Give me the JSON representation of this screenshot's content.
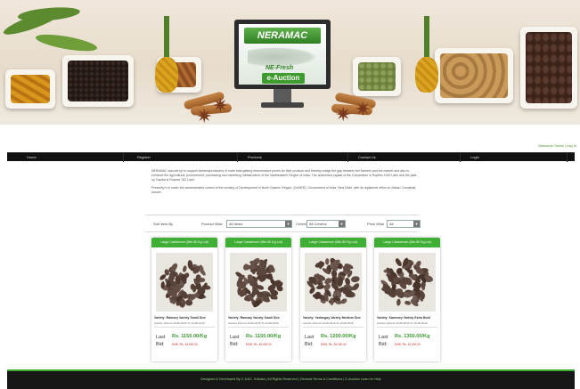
{
  "brand": {
    "logo_text": "NERAMAC",
    "subtitle": "NE-Fresh",
    "tagline": "e-Auction"
  },
  "header": {
    "welcome": "Welcome Guest | Log In"
  },
  "nav": {
    "items": [
      {
        "label": "Home"
      },
      {
        "label": "Register"
      },
      {
        "label": "Products"
      },
      {
        "label": "Contact Us"
      },
      {
        "label": "Login"
      }
    ]
  },
  "intro": {
    "paragraph1": "NERAMAC was set up to support farmers/producers of north east getting remunerative prices for their produce and thereby bridge the gap between the farmers and the market and also to enhance the agricultural, procurement, processing and marketing infrastructure of the Northeastern Region of India. The authorised capital of the Corporation is Rupees 1000 Lakh and the paid-up Capital is Rupees 762 Lakh.",
    "paragraph2": "Presently it is under the administrative control of the ministry of Development of North Eastern Region, (DoNER), Government of India. New Delhi, with its registered office at Ulubari, Guwahati, Assam."
  },
  "filters": {
    "sort_label": "Sort Item By",
    "product_label": "Product Wise",
    "product_value": "All Items",
    "centre_label": "Centre Wise",
    "centre_value": "All Centres",
    "price_label": "Price Wise",
    "price_value": "All"
  },
  "cards": [
    {
      "title": "Large Cardamom (Min.50 Kg Lot)",
      "variety": "Variety: Ramsey Variety Small Size",
      "period": "Auction Period: 04-08-2016 To 10-08-2016",
      "last_label": "Last",
      "bid_label": "Bid:",
      "price": "Rs. 1150.00/Kg",
      "emd": "EMD: Rs. 34,500.00"
    },
    {
      "title": "Large Cardamom (Min.50 Kg Lot)",
      "variety": "Variety: Ramsay Variety Small Size",
      "period": "Auction Period: 04-08-2016 To 10-08-2016",
      "last_label": "Last",
      "bid_label": "Bid:",
      "price": "Rs. 1150.00/Kg",
      "emd": "EMD: Rs. 46,000.00"
    },
    {
      "title": "Large Cardamom (Min.50 Kg Lot)",
      "variety": "Variety: Varlangay Variety Medium Size",
      "period": "Auction Period: 04-08-2016 To 10-08-2016",
      "last_label": "Last",
      "bid_label": "Bid:",
      "price": "Rs. 1200.00/Kg",
      "emd": "EMD: Rs. 36,000.00"
    },
    {
      "title": "Large Cardamom (Min.50 Kg Lot)",
      "variety": "Variety: Sawnney Variety Extra Bold",
      "period": "Auction Period: 04-08-2016 To 10-08-2016",
      "last_label": "Last",
      "bid_label": "Bid:",
      "price": "Rs. 1350.00/Kg",
      "emd": "EMD: Rs. 15,000.00"
    }
  ],
  "footer": {
    "text": "Designed & Developed By C-DAC, Kolkata | All Rights Reserved | General Terms & Conditions | E-Auction Learn to Help"
  },
  "colors": {
    "accent": "#3fae34",
    "price": "#3a9a2f",
    "nav_bg": "#111111",
    "emd": "#c03030"
  }
}
